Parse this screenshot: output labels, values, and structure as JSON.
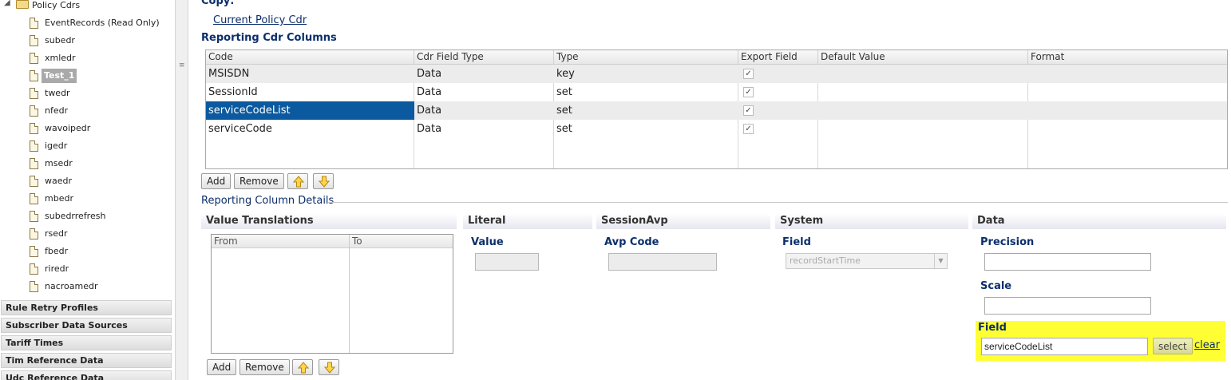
{
  "sidebar": {
    "folder_label": "Policy Cdrs",
    "items": [
      {
        "label": "EventRecords (Read Only)"
      },
      {
        "label": "subedr"
      },
      {
        "label": "xmledr"
      },
      {
        "label": "Test_1"
      },
      {
        "label": "twedr"
      },
      {
        "label": "nfedr"
      },
      {
        "label": "wavoipedr"
      },
      {
        "label": "igedr"
      },
      {
        "label": "msedr"
      },
      {
        "label": "waedr"
      },
      {
        "label": "mbedr"
      },
      {
        "label": "subedrrefresh"
      },
      {
        "label": "rsedr"
      },
      {
        "label": "fbedr"
      },
      {
        "label": "riredr"
      },
      {
        "label": "nacroamedr"
      }
    ],
    "accordions": [
      "Rule Retry Profiles",
      "Subscriber Data Sources",
      "Tariff Times",
      "Tim Reference Data",
      "Udc Reference Data"
    ]
  },
  "main": {
    "copy_title": "Copy:",
    "copy_link": "Current Policy Cdr",
    "columns_title": "Reporting Cdr Columns",
    "grid": {
      "headers": [
        "Code",
        "Cdr Field Type",
        "Type",
        "Export Field",
        "Default Value",
        "Format"
      ],
      "rows": [
        {
          "code": "MSISDN",
          "cdr_field_type": "Data",
          "type": "key",
          "export": true,
          "default_value": "",
          "format": ""
        },
        {
          "code": "SessionId",
          "cdr_field_type": "Data",
          "type": "set",
          "export": true,
          "default_value": "",
          "format": ""
        },
        {
          "code": "serviceCodeList",
          "cdr_field_type": "Data",
          "type": "set",
          "export": true,
          "default_value": "",
          "format": ""
        },
        {
          "code": "serviceCode",
          "cdr_field_type": "Data",
          "type": "set",
          "export": true,
          "default_value": "",
          "format": ""
        }
      ]
    },
    "buttons": {
      "add": "Add",
      "remove": "Remove"
    },
    "details_title": "Reporting Column Details",
    "panels": {
      "value_translations": {
        "title": "Value Translations",
        "headers": [
          "From",
          "To"
        ]
      },
      "literal": {
        "title": "Literal",
        "value_label": "Value",
        "value": ""
      },
      "session_avp": {
        "title": "SessionAvp",
        "avp_label": "Avp Code",
        "avp_value": ""
      },
      "system": {
        "title": "System",
        "field_label": "Field",
        "field_value": "recordStartTime"
      },
      "data": {
        "title": "Data",
        "precision_label": "Precision",
        "precision_value": "",
        "scale_label": "Scale",
        "scale_value": "",
        "field_label": "Field",
        "field_value": "serviceCodeList",
        "select_label": "select",
        "clear_label": "clear"
      }
    }
  },
  "colors": {
    "selection": "#0b5aa0",
    "highlight": "#ffff33",
    "heading": "#0b2e6b"
  }
}
